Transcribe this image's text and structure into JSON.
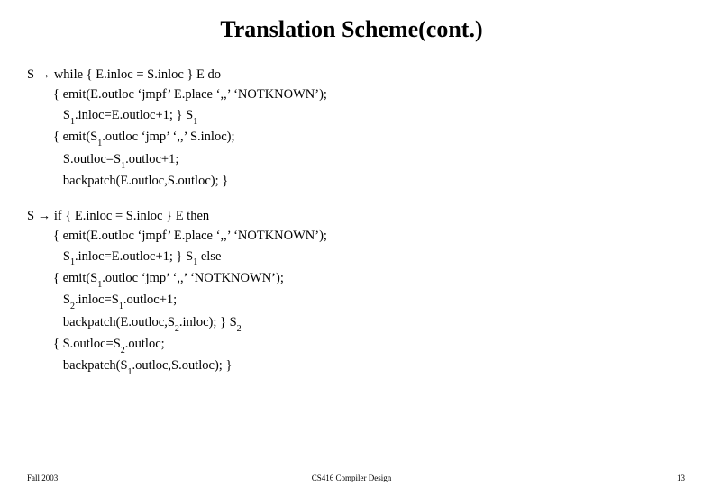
{
  "title": "Translation Scheme(cont.)",
  "rule1": {
    "l1a": "S ",
    "l1b": " while { E.inloc = S.inloc } E do",
    "l2": "        { emit(E.outloc ‘jmpf’ E.place ‘,,’ ‘NOTKNOWN’);",
    "l3a": "           S",
    "l3b": ".inloc=E.outloc+1; } S",
    "l3c": "",
    "l4a": "        { emit(S",
    "l4b": ".outloc ‘jmp’ ‘,,’ S.inloc);",
    "l5a": "           S.outloc=S",
    "l5b": ".outloc+1;",
    "l6": "           backpatch(E.outloc,S.outloc); }"
  },
  "rule2": {
    "l1a": "S ",
    "l1b": " if { E.inloc = S.inloc } E then",
    "l2": "        { emit(E.outloc ‘jmpf’ E.place ‘,,’ ‘NOTKNOWN’);",
    "l3a": "           S",
    "l3b": ".inloc=E.outloc+1; } S",
    "l3c": " else",
    "l4a": "        { emit(S",
    "l4b": ".outloc ‘jmp’ ‘,,’ ‘NOTKNOWN’);",
    "l5a": "           S",
    "l5b": ".inloc=S",
    "l5c": ".outloc+1;",
    "l6a": "           backpatch(E.outloc,S",
    "l6b": ".inloc); } S",
    "l6c": "",
    "l7a": "        { S.outloc=S",
    "l7b": ".outloc;",
    "l8a": "           backpatch(S",
    "l8b": ".outloc,S.outloc); }"
  },
  "subs": {
    "one": "1",
    "two": "2"
  },
  "arrow": "→",
  "footer": {
    "left": "Fall 2003",
    "center": "CS416 Compiler Design",
    "right": "13"
  }
}
